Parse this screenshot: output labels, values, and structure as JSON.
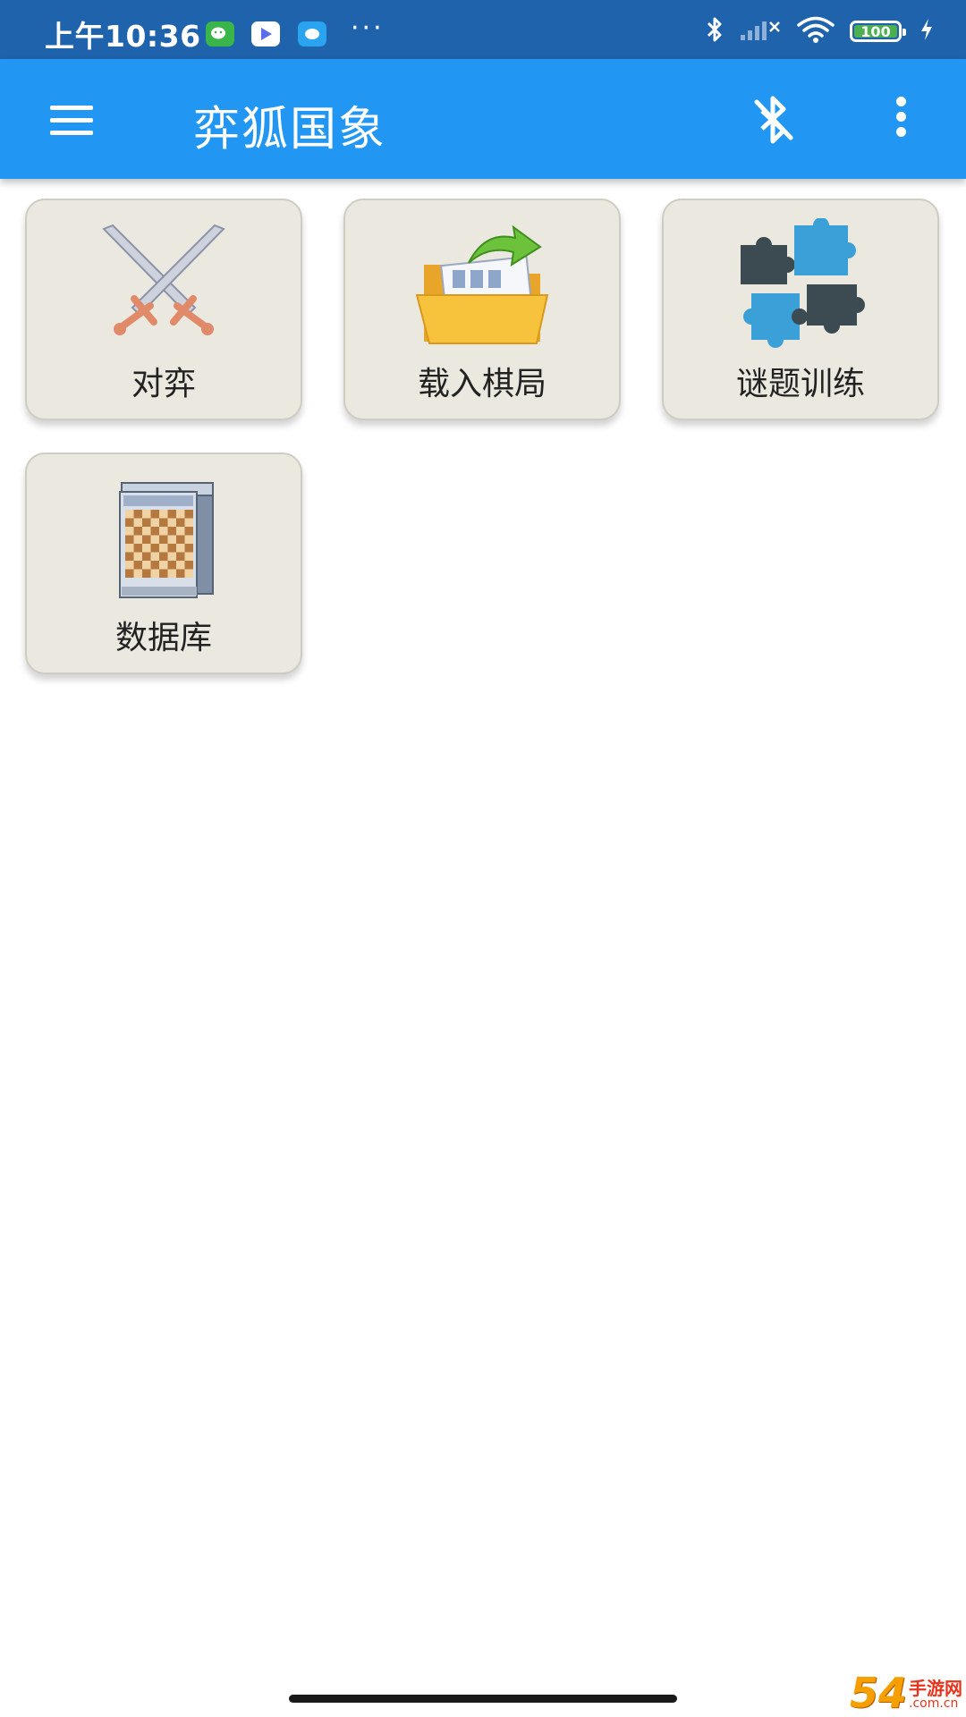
{
  "status_bar": {
    "time": "上午10:36",
    "notification_icons": [
      "wechat-icon",
      "video-app-icon",
      "message-app-icon"
    ],
    "more": "···",
    "battery": "100",
    "icons": [
      "bluetooth-icon",
      "signal-icon",
      "wifi-icon",
      "battery-icon",
      "charging-icon"
    ]
  },
  "app_bar": {
    "title": "弈狐国象",
    "actions": [
      "menu-icon",
      "bluetooth-off-icon",
      "overflow-menu-icon"
    ]
  },
  "tiles": [
    {
      "label": "对弈",
      "icon": "crossed-swords-icon"
    },
    {
      "label": "载入棋局",
      "icon": "open-folder-icon"
    },
    {
      "label": "谜题训练",
      "icon": "puzzle-icon"
    },
    {
      "label": "数据库",
      "icon": "database-chessboard-icon"
    }
  ],
  "watermark": {
    "big": "54"
  },
  "colors": {
    "status_bar": "#1f63ad",
    "app_bar": "#2196f3",
    "tile_bg": "#ebe9df"
  }
}
